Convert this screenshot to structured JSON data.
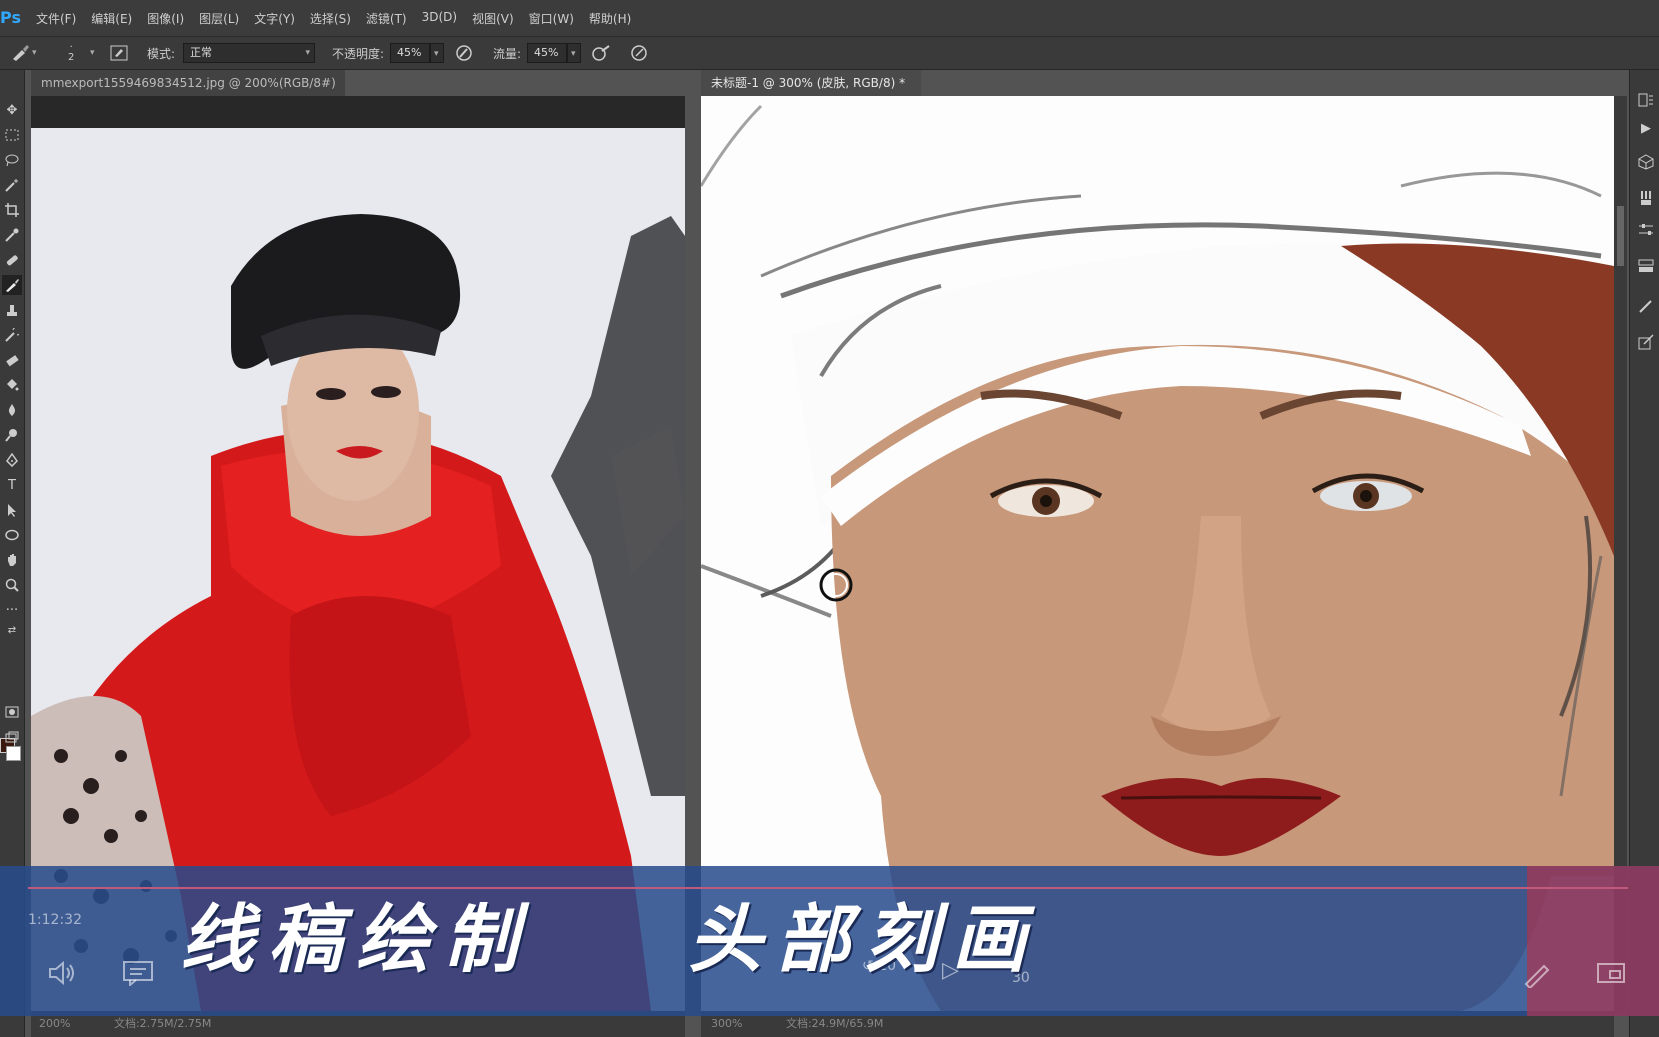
{
  "app": {
    "logo": "Ps"
  },
  "menu": [
    "文件(F)",
    "编辑(E)",
    "图像(I)",
    "图层(L)",
    "文字(Y)",
    "选择(S)",
    "滤镜(T)",
    "3D(D)",
    "视图(V)",
    "窗口(W)",
    "帮助(H)"
  ],
  "options": {
    "brush_size": "2",
    "mode_label": "模式:",
    "mode_value": "正常",
    "opacity_label": "不透明度:",
    "opacity_value": "45%",
    "flow_label": "流量:",
    "flow_value": "45%"
  },
  "tabs": [
    {
      "title": "mmexport1559469834512.jpg @ 200%(RGB/8#) *",
      "close": "×"
    },
    {
      "title": "未标题-1 @ 300% (皮肤, RGB/8) *",
      "close": "×"
    }
  ],
  "status": {
    "left_zoom": "200%",
    "left_doc": "文档:2.75M/2.75M",
    "right_zoom": "300%",
    "right_doc": "文档:24.9M/65.9M"
  },
  "colors": {
    "foreground": "#3a1a10",
    "background": "#ffffff",
    "accent": "#31a8ff"
  },
  "video": {
    "timestamp": "1:12:32",
    "caption_left": "线稿绘制",
    "caption_right": "头部刻画",
    "rewind_label": "10",
    "forward_label": "30"
  }
}
